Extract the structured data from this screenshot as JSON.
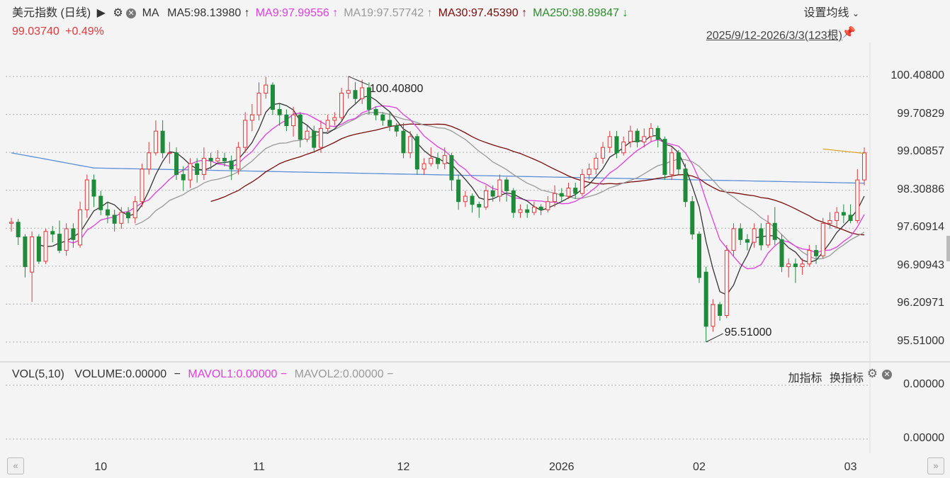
{
  "header": {
    "title": "美元指数 (日线)",
    "play_icon": "play-icon",
    "ma_label": "MA",
    "ma": [
      {
        "text": "MA5:98.13980",
        "arrow": "↑",
        "color": "#333333"
      },
      {
        "text": "MA9:97.99556",
        "arrow": "↑",
        "color": "#e03ee0"
      },
      {
        "text": "MA19:97.57742",
        "arrow": "↑",
        "color": "#999999"
      },
      {
        "text": "MA30:97.45390",
        "arrow": "↑",
        "color": "#7a0c0c"
      },
      {
        "text": "MA250:98.89847",
        "arrow": "↓",
        "color": "#2e8b2e"
      }
    ],
    "settings_label": "设置均线",
    "price": "99.03740",
    "change": "+0.49%",
    "range": "2025/9/12-2026/3/3(123根)"
  },
  "chart_data": {
    "type": "candlestick",
    "ylim": [
      95.3,
      100.7
    ],
    "yticks": [
      "100.40800",
      "99.70829",
      "99.00857",
      "98.30886",
      "97.60914",
      "96.90943",
      "96.20971",
      "95.51000"
    ],
    "xticks": [
      "10",
      "11",
      "12",
      "2026",
      "02",
      "03"
    ],
    "high_annotation": "100.40800",
    "low_annotation": "95.51000",
    "ma_colors": {
      "ma5": "#333333",
      "ma9": "#e03ee0",
      "ma19": "#999999",
      "ma30": "#7a0c0c",
      "ma250": "#5b8fd6"
    },
    "candles": [
      [
        97.7,
        97.72,
        97.8,
        97.55
      ],
      [
        97.72,
        97.45,
        97.78,
        97.3
      ],
      [
        97.45,
        96.9,
        97.5,
        96.7
      ],
      [
        96.8,
        97.45,
        97.55,
        96.25
      ],
      [
        97.45,
        97.0,
        97.5,
        96.95
      ],
      [
        97.0,
        97.55,
        97.6,
        96.95
      ],
      [
        97.55,
        97.5,
        97.65,
        97.35
      ],
      [
        97.5,
        97.2,
        97.75,
        97.15
      ],
      [
        97.2,
        97.6,
        97.7,
        97.1
      ],
      [
        97.6,
        97.4,
        97.7,
        97.25
      ],
      [
        97.3,
        97.95,
        98.1,
        97.25
      ],
      [
        97.95,
        98.5,
        98.6,
        97.8
      ],
      [
        98.5,
        98.2,
        98.6,
        98.0
      ],
      [
        98.2,
        97.95,
        98.3,
        97.85
      ],
      [
        97.95,
        97.85,
        98.1,
        97.7
      ],
      [
        97.85,
        97.7,
        97.95,
        97.55
      ],
      [
        97.7,
        97.9,
        98.0,
        97.6
      ],
      [
        97.9,
        97.8,
        98.0,
        97.7
      ],
      [
        97.8,
        98.1,
        98.2,
        97.7
      ],
      [
        98.1,
        98.7,
        98.8,
        98.0
      ],
      [
        98.7,
        99.0,
        99.2,
        98.6
      ],
      [
        99.0,
        99.4,
        99.6,
        98.95
      ],
      [
        99.4,
        99.0,
        99.6,
        98.9
      ],
      [
        99.0,
        99.0,
        99.2,
        98.8
      ],
      [
        99.0,
        98.6,
        99.1,
        98.5
      ],
      [
        98.6,
        98.5,
        98.75,
        98.3
      ],
      [
        98.5,
        98.8,
        98.9,
        98.35
      ],
      [
        98.8,
        98.6,
        98.9,
        98.45
      ],
      [
        98.6,
        98.9,
        99.1,
        98.5
      ],
      [
        98.9,
        98.85,
        99.0,
        98.7
      ],
      [
        98.85,
        98.9,
        99.05,
        98.8
      ],
      [
        98.9,
        98.85,
        99.0,
        98.75
      ],
      [
        98.85,
        98.7,
        98.95,
        98.5
      ],
      [
        98.7,
        99.1,
        99.2,
        98.6
      ],
      [
        99.1,
        99.6,
        99.75,
        99.0
      ],
      [
        99.6,
        99.7,
        99.9,
        99.4
      ],
      [
        99.7,
        100.1,
        100.3,
        99.6
      ],
      [
        100.1,
        100.25,
        100.4,
        100.0
      ],
      [
        100.25,
        99.8,
        100.3,
        99.7
      ],
      [
        99.8,
        99.7,
        99.9,
        99.5
      ],
      [
        99.7,
        99.5,
        99.8,
        99.4
      ],
      [
        99.5,
        99.7,
        99.85,
        99.3
      ],
      [
        99.7,
        99.25,
        99.75,
        99.1
      ],
      [
        99.25,
        99.4,
        99.5,
        99.2
      ],
      [
        99.4,
        99.1,
        99.5,
        99.0
      ],
      [
        99.1,
        99.45,
        99.6,
        99.0
      ],
      [
        99.45,
        99.6,
        99.7,
        99.4
      ],
      [
        99.6,
        99.65,
        99.75,
        99.5
      ],
      [
        99.65,
        100.1,
        100.2,
        99.6
      ],
      [
        100.1,
        100.15,
        100.41,
        100.0
      ],
      [
        100.15,
        100.0,
        100.3,
        99.9
      ],
      [
        100.0,
        100.2,
        100.35,
        99.9
      ],
      [
        100.2,
        99.8,
        100.3,
        99.7
      ],
      [
        99.8,
        99.7,
        99.85,
        99.6
      ],
      [
        99.7,
        99.6,
        99.75,
        99.5
      ],
      [
        99.6,
        99.5,
        99.75,
        99.4
      ],
      [
        99.5,
        99.4,
        99.55,
        99.3
      ],
      [
        99.4,
        99.0,
        99.55,
        98.9
      ],
      [
        99.0,
        99.3,
        99.4,
        98.9
      ],
      [
        99.3,
        98.7,
        99.35,
        98.6
      ],
      [
        98.7,
        98.8,
        98.9,
        98.6
      ],
      [
        98.8,
        98.9,
        99.1,
        98.75
      ],
      [
        98.9,
        98.8,
        99.0,
        98.7
      ],
      [
        98.8,
        98.95,
        99.1,
        98.7
      ],
      [
        98.95,
        98.5,
        99.0,
        98.3
      ],
      [
        98.5,
        98.1,
        98.6,
        97.95
      ],
      [
        98.1,
        98.2,
        98.3,
        98.0
      ],
      [
        98.2,
        98.05,
        98.25,
        97.9
      ],
      [
        98.05,
        98.0,
        98.1,
        97.8
      ],
      [
        98.0,
        98.3,
        98.4,
        97.95
      ],
      [
        98.3,
        98.2,
        98.4,
        98.1
      ],
      [
        98.2,
        98.5,
        98.6,
        98.1
      ],
      [
        98.5,
        98.3,
        98.55,
        98.1
      ],
      [
        98.3,
        97.9,
        98.35,
        97.8
      ],
      [
        97.9,
        97.95,
        98.05,
        97.8
      ],
      [
        97.95,
        97.9,
        98.05,
        97.8
      ],
      [
        97.9,
        98.0,
        98.1,
        97.85
      ],
      [
        98.0,
        97.95,
        98.05,
        97.85
      ],
      [
        97.95,
        98.1,
        98.2,
        97.9
      ],
      [
        98.1,
        98.25,
        98.4,
        98.0
      ],
      [
        98.25,
        98.2,
        98.35,
        98.1
      ],
      [
        98.2,
        98.35,
        98.45,
        98.15
      ],
      [
        98.35,
        98.25,
        98.45,
        98.15
      ],
      [
        98.25,
        98.6,
        98.7,
        98.2
      ],
      [
        98.6,
        98.7,
        98.8,
        98.5
      ],
      [
        98.7,
        98.9,
        99.0,
        98.6
      ],
      [
        98.9,
        99.1,
        99.2,
        98.8
      ],
      [
        99.1,
        99.3,
        99.4,
        99.0
      ],
      [
        99.3,
        99.0,
        99.4,
        98.9
      ],
      [
        99.0,
        99.2,
        99.3,
        98.95
      ],
      [
        99.2,
        99.4,
        99.5,
        99.1
      ],
      [
        99.4,
        99.2,
        99.45,
        99.1
      ],
      [
        99.2,
        99.3,
        99.45,
        99.1
      ],
      [
        99.3,
        99.45,
        99.55,
        99.2
      ],
      [
        99.45,
        99.25,
        99.5,
        99.1
      ],
      [
        99.25,
        98.6,
        99.3,
        98.5
      ],
      [
        98.6,
        99.0,
        99.1,
        98.5
      ],
      [
        99.0,
        98.7,
        99.05,
        98.6
      ],
      [
        98.7,
        98.1,
        98.8,
        98.0
      ],
      [
        98.1,
        97.5,
        98.2,
        97.4
      ],
      [
        97.5,
        96.7,
        97.55,
        96.6
      ],
      [
        96.8,
        95.8,
        96.9,
        95.51
      ],
      [
        95.8,
        96.2,
        96.3,
        95.7
      ],
      [
        96.2,
        96.0,
        96.25,
        95.9
      ],
      [
        96.0,
        97.2,
        97.3,
        95.95
      ],
      [
        97.2,
        97.6,
        97.7,
        97.1
      ],
      [
        97.6,
        97.4,
        97.7,
        97.3
      ],
      [
        97.4,
        97.35,
        97.5,
        97.2
      ],
      [
        97.35,
        97.6,
        97.7,
        97.25
      ],
      [
        97.6,
        97.3,
        97.7,
        97.2
      ],
      [
        97.3,
        97.7,
        97.85,
        97.25
      ],
      [
        97.7,
        97.4,
        98.0,
        97.3
      ],
      [
        97.4,
        96.9,
        97.5,
        96.8
      ],
      [
        96.9,
        96.95,
        97.05,
        96.7
      ],
      [
        96.95,
        96.9,
        97.05,
        96.6
      ],
      [
        96.9,
        96.95,
        97.05,
        96.75
      ],
      [
        96.95,
        97.2,
        97.3,
        96.9
      ],
      [
        97.2,
        97.1,
        97.3,
        96.95
      ],
      [
        97.1,
        97.7,
        97.8,
        97.05
      ],
      [
        97.7,
        97.75,
        97.9,
        97.6
      ],
      [
        97.75,
        97.9,
        98.0,
        97.6
      ],
      [
        97.9,
        97.85,
        98.05,
        97.7
      ],
      [
        97.85,
        97.75,
        98.05,
        97.7
      ],
      [
        97.75,
        98.5,
        98.7,
        97.7
      ],
      [
        98.5,
        99.0,
        99.1,
        98.4
      ]
    ],
    "volume": {
      "label": "VOL(5,10)",
      "volume_text": "VOLUME:0.00000",
      "mavol1_text": "MAVOL1:0.00000",
      "mavol2_text": "MAVOL2:0.00000",
      "yticks": [
        "0.00000",
        "0.00000"
      ]
    }
  },
  "indicator_controls": {
    "add": "加指标",
    "switch": "换指标"
  },
  "colors": {
    "up": "#e0393e",
    "down": "#1f8a3a",
    "grid": "#b0b0b0"
  }
}
